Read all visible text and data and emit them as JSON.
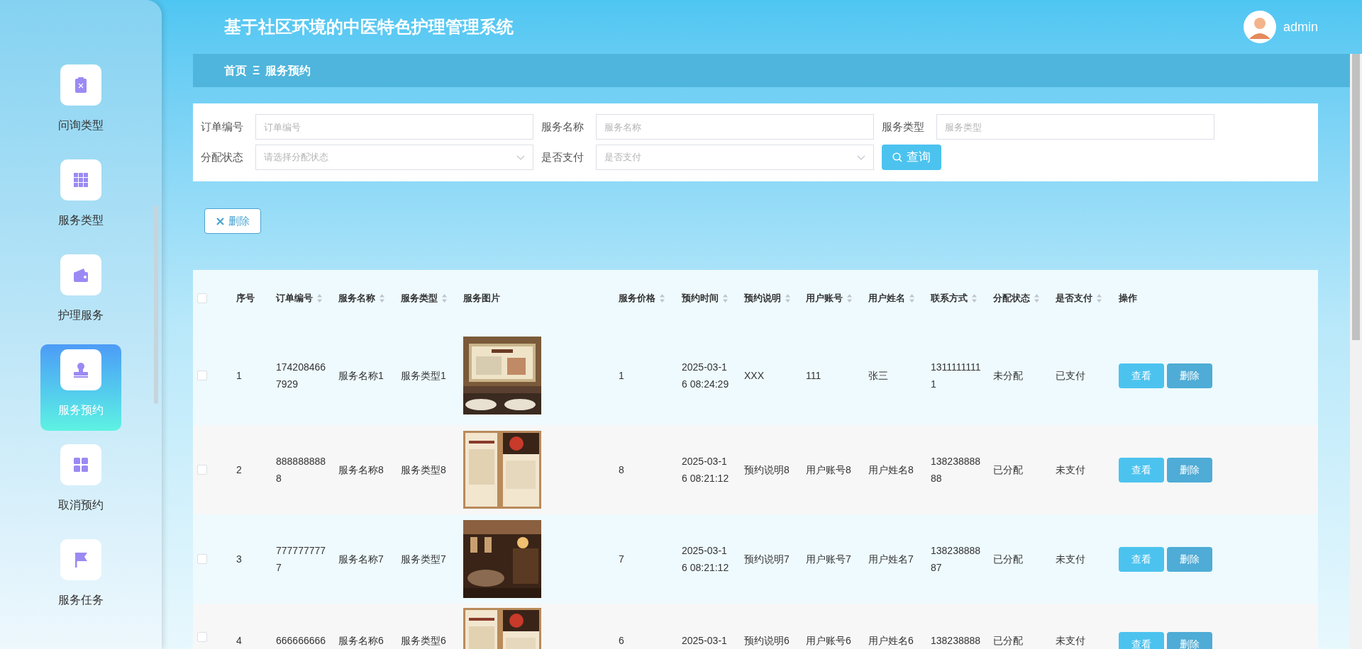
{
  "sidebar": {
    "items": [
      {
        "label": "问询类型",
        "selected": false
      },
      {
        "label": "服务类型",
        "selected": false
      },
      {
        "label": "护理服务",
        "selected": false
      },
      {
        "label": "服务预约",
        "selected": true
      },
      {
        "label": "取消预约",
        "selected": false
      },
      {
        "label": "服务任务",
        "selected": false
      }
    ]
  },
  "header": {
    "title": "基于社区环境的中医特色护理管理系统",
    "user": "admin"
  },
  "breadcrumb": {
    "home": "首页",
    "separator": "Ξ",
    "current": "服务预约"
  },
  "search": {
    "fields": [
      {
        "kind": "input",
        "label": "订单编号",
        "placeholder": "订单编号"
      },
      {
        "kind": "input",
        "label": "服务名称",
        "placeholder": "服务名称"
      },
      {
        "kind": "input",
        "label": "服务类型",
        "placeholder": "服务类型"
      },
      {
        "kind": "select",
        "label": "分配状态",
        "placeholder": "请选择分配状态"
      },
      {
        "kind": "select",
        "label": "是否支付",
        "placeholder": "是否支付"
      }
    ],
    "button": "查询"
  },
  "toolbar": {
    "delete_button": "删除"
  },
  "table": {
    "select_all": {
      "checked": false
    },
    "columns": [
      {
        "label": "序号",
        "sortable": false
      },
      {
        "label": "订单编号",
        "sortable": true
      },
      {
        "label": "服务名称",
        "sortable": true
      },
      {
        "label": "服务类型",
        "sortable": true
      },
      {
        "label": "服务图片",
        "sortable": false
      },
      {
        "label": "服务价格",
        "sortable": true
      },
      {
        "label": "预约时间",
        "sortable": true
      },
      {
        "label": "预约说明",
        "sortable": true
      },
      {
        "label": "用户账号",
        "sortable": true
      },
      {
        "label": "用户姓名",
        "sortable": true
      },
      {
        "label": "联系方式",
        "sortable": true
      },
      {
        "label": "分配状态",
        "sortable": true
      },
      {
        "label": "是否支付",
        "sortable": true
      },
      {
        "label": "操作",
        "sortable": false
      }
    ],
    "rows": [
      {
        "checked": false,
        "cells": [
          "1",
          "1742084667929",
          "服务名称1",
          "服务类型1",
          null,
          "1",
          "2025-03-16 08:24:29",
          "XXX",
          "111",
          "张三",
          "13111111111",
          "未分配",
          "已支付"
        ],
        "actions": [
          "查看",
          "删除"
        ]
      },
      {
        "checked": false,
        "cells": [
          "2",
          "8888888888",
          "服务名称8",
          "服务类型8",
          null,
          "8",
          "2025-03-16 08:21:12",
          "预约说明8",
          "用户账号8",
          "用户姓名8",
          "13823888888",
          "已分配",
          "未支付"
        ],
        "actions": [
          "查看",
          "删除"
        ]
      },
      {
        "checked": false,
        "cells": [
          "3",
          "7777777777",
          "服务名称7",
          "服务类型7",
          null,
          "7",
          "2025-03-16 08:21:12",
          "预约说明7",
          "用户账号7",
          "用户姓名7",
          "13823888887",
          "已分配",
          "未支付"
        ],
        "actions": [
          "查看",
          "删除"
        ]
      },
      {
        "checked": false,
        "cells": [
          "4",
          "666666666",
          "服务名称6",
          "服务类型6",
          null,
          "6",
          "2025-03-1",
          "预约说明6",
          "用户账号6",
          "用户姓名6",
          "138238888",
          "已分配",
          "未支付"
        ],
        "actions": [
          "查看",
          "删除"
        ]
      }
    ]
  }
}
